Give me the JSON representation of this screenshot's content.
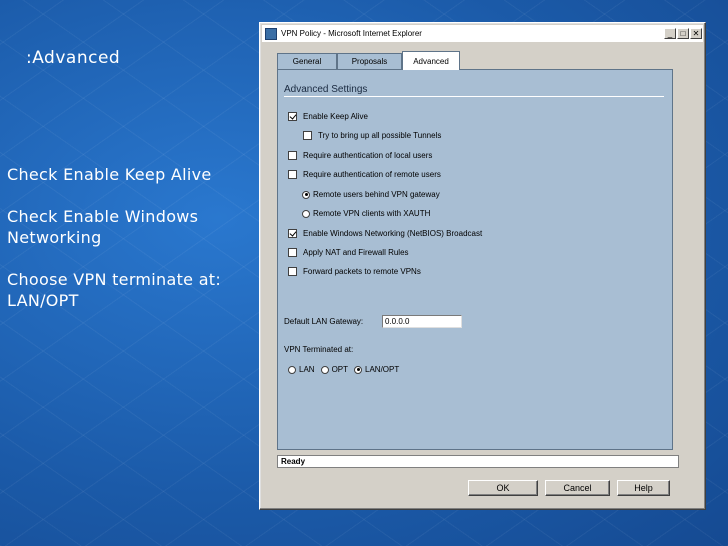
{
  "slide": {
    "heading": ":Advanced",
    "notes": [
      "Check Enable Keep Alive",
      "Check Enable Windows Networking",
      "Choose VPN terminate at: LAN/OPT"
    ]
  },
  "window": {
    "title": "VPN Policy - Microsoft Internet Explorer",
    "controls": {
      "minimize": "_",
      "maximize": "□",
      "close": "✕"
    }
  },
  "tabs": [
    "General",
    "Proposals",
    "Advanced"
  ],
  "active_tab": "Advanced",
  "advanced": {
    "section_title": "Advanced Settings",
    "options": {
      "keep_alive": {
        "label": "Enable Keep Alive",
        "checked": true
      },
      "bring_up_tunnels": {
        "label": "Try to bring up all possible Tunnels",
        "checked": false
      },
      "auth_local": {
        "label": "Require authentication of local users",
        "checked": false
      },
      "auth_remote": {
        "label": "Require authentication of remote users",
        "checked": false
      },
      "remote_behind_gw": {
        "label": "Remote users behind VPN gateway",
        "selected": true
      },
      "remote_xauth": {
        "label": "Remote VPN clients with XAUTH",
        "selected": false
      },
      "netbios": {
        "label": "Enable Windows Networking (NetBIOS) Broadcast",
        "checked": true
      },
      "nat_rules": {
        "label": "Apply NAT and Firewall Rules",
        "checked": false
      },
      "forward_packets": {
        "label": "Forward packets to remote VPNs",
        "checked": false
      }
    },
    "default_lan_gateway": {
      "label": "Default LAN Gateway:",
      "value": "0.0.0.0"
    },
    "vpn_terminated": {
      "label": "VPN Terminated at:",
      "options": [
        {
          "label": "LAN",
          "selected": false
        },
        {
          "label": "OPT",
          "selected": false
        },
        {
          "label": "LAN/OPT",
          "selected": true
        }
      ]
    }
  },
  "status": "Ready",
  "buttons": {
    "ok": "OK",
    "cancel": "Cancel",
    "help": "Help"
  }
}
